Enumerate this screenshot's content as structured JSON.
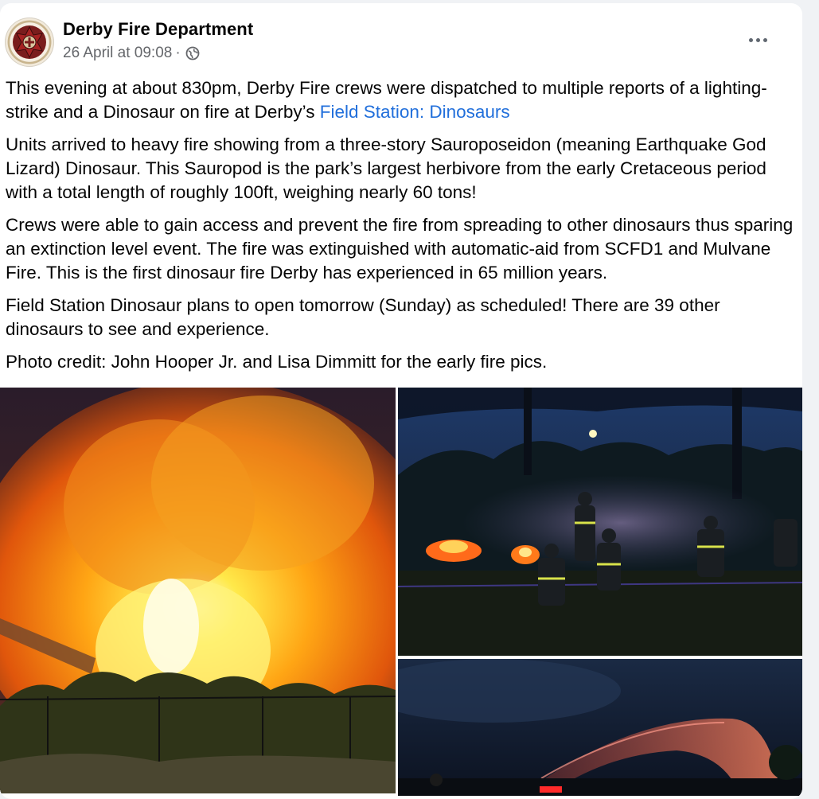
{
  "post": {
    "page_name": "Derby Fire Department",
    "timestamp": "26 April at 09:08",
    "separator": "·",
    "audience_icon": "globe-icon",
    "more_icon": "more-options-icon",
    "paragraphs": [
      {
        "text": "This evening at about 830pm, Derby Fire crews were dispatched to multiple reports of a lighting-strike and a Dinosaur on fire at Derby’s ",
        "link": "Field Station: Dinosaurs"
      },
      {
        "text": "Units arrived to heavy fire showing from a three-story Sauroposeidon (meaning Earthquake God Lizard) Dinosaur. This Sauropod is the park’s largest herbivore from the early Cretaceous period with a total length of roughly 100ft, weighing nearly 60 tons!"
      },
      {
        "text": "Crews were able to gain access and prevent the fire from spreading to other dinosaurs thus sparing an extinction level event. The fire was extinguished with automatic-aid from SCFD1 and Mulvane Fire. This is the first dinosaur fire Derby has experienced in 65 million years."
      },
      {
        "text": "Field Station Dinosaur plans to open tomorrow (Sunday) as scheduled! There are 39 other dinosaurs to see and experience."
      },
      {
        "text": "Photo credit:  John Hooper Jr. and Lisa Dimmitt for the early fire pics."
      }
    ]
  },
  "colors": {
    "link": "#216fdb",
    "secondary_text": "#65676b",
    "card_bg": "#ffffff",
    "page_bg": "#f0f2f5"
  },
  "photos": [
    {
      "name": "photo-fire-large"
    },
    {
      "name": "photo-firefighters-night"
    },
    {
      "name": "photo-hose-spray"
    }
  ]
}
